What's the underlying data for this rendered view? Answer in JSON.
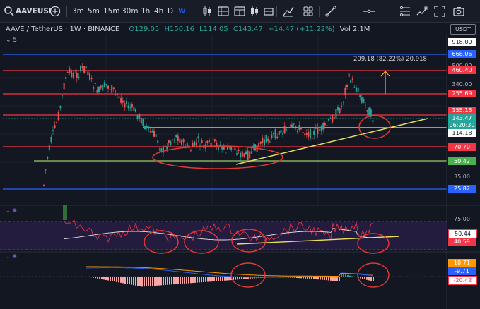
{
  "toolbar": {
    "symbol": "AAVEUSI",
    "intervals": [
      "3m",
      "5m",
      "15m",
      "30m",
      "1h",
      "4h",
      "D",
      "W"
    ],
    "active_interval": "W"
  },
  "legend": {
    "title": "AAVE / TetherUS · 1W · BINANCE",
    "open": "O129.05",
    "high": "H150.16",
    "low": "L114.05",
    "close": "C143.47",
    "change": "+14.47 (+11.22%)",
    "volume": "Vol 2.1M"
  },
  "sub_label": "5",
  "currency": "USDT",
  "price_labels": [
    {
      "text": "918.00",
      "bg": "#ffffff",
      "fg": "#131722"
    },
    {
      "text": "668.06",
      "bg": "#2962ff",
      "fg": "#ffffff"
    },
    {
      "text": "460.40",
      "bg": "#f23645",
      "fg": "#ffffff"
    },
    {
      "text": "255.69",
      "bg": "#f23645",
      "fg": "#ffffff"
    },
    {
      "text": "155.16",
      "bg": "#f23645",
      "fg": "#ffffff"
    },
    {
      "text": "143.47",
      "bg": "#26a69a",
      "fg": "#ffffff"
    },
    {
      "text": "06:20:30",
      "bg": "#26a69a",
      "fg": "#ffffff"
    },
    {
      "text": "114.18",
      "bg": "#ffffff",
      "fg": "#131722"
    },
    {
      "text": "70.70",
      "bg": "#f23645",
      "fg": "#ffffff"
    },
    {
      "text": "50.42",
      "bg": "#4caf50",
      "fg": "#ffffff"
    },
    {
      "text": "25.82",
      "bg": "#2962ff",
      "fg": "#ffffff"
    }
  ],
  "axis_ticks": [
    "500.00",
    "340.00",
    "35.00"
  ],
  "measure_text": "209.18 (82.22%) 20,918",
  "rsi": {
    "level": "75.00",
    "labels": [
      {
        "text": "50.44",
        "bg": "#ffffff",
        "fg": "#131722"
      },
      {
        "text": "40.59",
        "bg": "#f23645",
        "fg": "#ffffff"
      }
    ]
  },
  "macd": {
    "labels": [
      {
        "text": "10.71",
        "bg": "#ff9800",
        "fg": "#ffffff"
      },
      {
        "text": "-9.71",
        "bg": "#2962ff",
        "fg": "#ffffff"
      },
      {
        "text": "-20.42",
        "bg": "#ffffff",
        "fg": "#f23645"
      }
    ]
  },
  "colors": {
    "background": "#131722",
    "support_red": "#f23645",
    "support_blue": "#2962ff",
    "support_green": "#4caf50",
    "trendline": "#e8e05a",
    "ellipse": "#e53935",
    "candle_up": "#26a69a",
    "candle_down": "#ef5350"
  },
  "icons": [
    "search-icon",
    "add-symbol-icon",
    "candle-type-icon",
    "indicators-icon",
    "templates-icon",
    "alert-icon",
    "replay-icon",
    "layout-icon",
    "trendline-tool-icon",
    "horizontal-line-tool-icon",
    "fib-tool-icon",
    "brush-tool-icon",
    "fullscreen-icon",
    "screenshot-icon"
  ]
}
